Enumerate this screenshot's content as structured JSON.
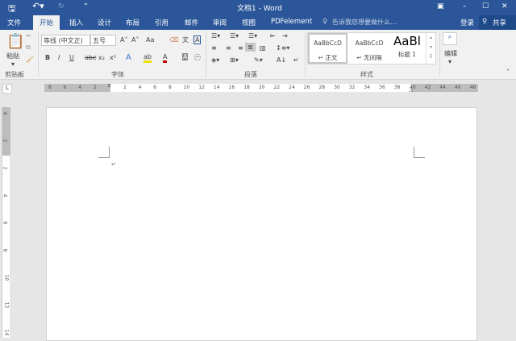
{
  "window": {
    "title": "文档1 - Word"
  },
  "quick_access": {
    "save_icon": "save-icon",
    "undo_icon": "undo-icon",
    "redo_icon": "redo-icon",
    "customize_icon": "customize-icon"
  },
  "tabs": [
    "文件",
    "开始",
    "插入",
    "设计",
    "布局",
    "引用",
    "邮件",
    "审阅",
    "视图",
    "PDFelement"
  ],
  "active_tab": "开始",
  "tell_me": "告诉我您想要做什么...",
  "signin": "登录",
  "share": "共享",
  "ribbon": {
    "clipboard": {
      "paste": "粘贴",
      "label": "剪贴板"
    },
    "font": {
      "font_name": "等线 (中文正)",
      "font_size": "五号",
      "label": "字体",
      "buttons": [
        "B",
        "I",
        "U",
        "abc",
        "x₂",
        "x²"
      ],
      "aa": "Aa"
    },
    "paragraph": {
      "label": "段落"
    },
    "styles": {
      "label": "样式",
      "items": [
        {
          "preview": "AaBbCcD",
          "name": "↵ 正文"
        },
        {
          "preview": "AaBbCcD",
          "name": "↵ 无间隔"
        },
        {
          "preview": "AaBl",
          "name": "标题 1"
        }
      ]
    },
    "editing": {
      "label": "编辑"
    }
  },
  "ruler": {
    "left_numbers": [
      "8",
      "6",
      "4",
      "2"
    ],
    "numbers": [
      "2",
      "4",
      "6",
      "8",
      "10",
      "12",
      "14",
      "16",
      "18",
      "20",
      "22",
      "24",
      "26",
      "28",
      "30",
      "32",
      "34",
      "36",
      "38"
    ],
    "right_numbers": [
      "40",
      "42",
      "44",
      "46",
      "48"
    ],
    "tab_selector": "L"
  },
  "vruler": {
    "numbers": [
      "4",
      "2",
      "2",
      "4",
      "6",
      "8",
      "10",
      "12",
      "14"
    ]
  },
  "document": {
    "paragraph_mark": "↵"
  },
  "colors": {
    "brand": "#2b579a",
    "highlight": "#f0e000",
    "font_color": "#c00000"
  }
}
